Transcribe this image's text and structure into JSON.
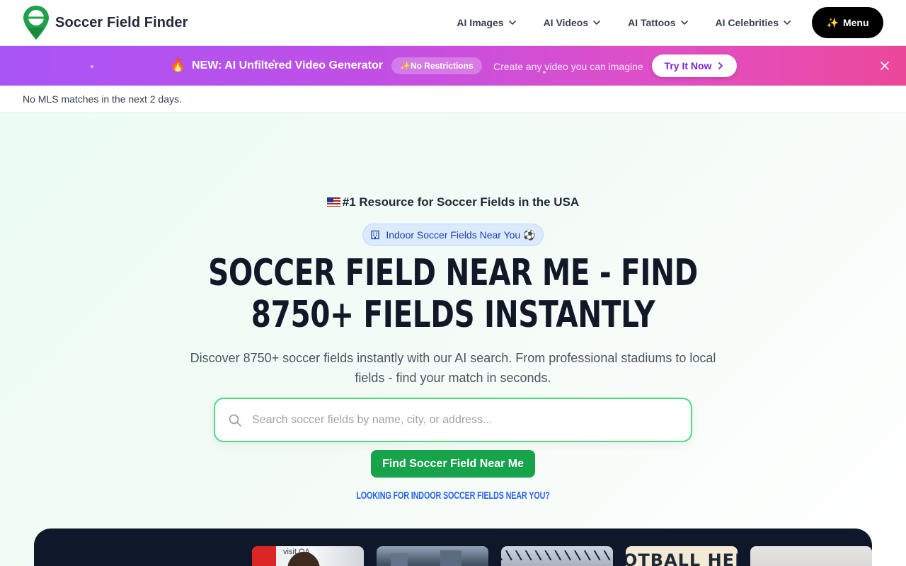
{
  "header": {
    "brand": "Soccer Field Finder",
    "nav": [
      {
        "label": "AI Images"
      },
      {
        "label": "AI Videos"
      },
      {
        "label": "AI Tattoos"
      },
      {
        "label": "AI Celebrities"
      }
    ],
    "menu_label": "Menu",
    "menu_icon": "✨"
  },
  "promo": {
    "icon": "🔥",
    "title": "NEW: AI Unfiltered Video Generator",
    "badge": "✨No Restrictions",
    "subtitle": "Create any video you can imagine",
    "cta": "Try It Now",
    "gradient_start": "#a855f7",
    "gradient_end": "#ec4899"
  },
  "mls": {
    "text": "No MLS matches in the next 2 days."
  },
  "hero": {
    "tagline": "#1 Resource for Soccer Fields in the USA",
    "pill_label": "Indoor Soccer Fields Near You",
    "pill_emoji": "⚽",
    "headline": "Soccer Field Near Me - Find 8750+ Fields Instantly",
    "description": "Discover 8750+ soccer fields instantly with our AI search. From professional stadiums to local fields - find your match in seconds.",
    "search_placeholder": "Search soccer fields by name, city, or address...",
    "search_value": "",
    "find_button": "Find Soccer Field Near Me",
    "indoor_link": "Looking for indoor soccer fields near you?"
  },
  "strip": {
    "thumb1_text": "visit QA",
    "thumb4_text": "OTBALL HERO"
  },
  "colors": {
    "accent_green": "#16a34a",
    "search_border": "#4ade80",
    "link_blue": "#2563eb",
    "pill_bg": "#dbeafe",
    "strip_bg": "#0f172a"
  }
}
